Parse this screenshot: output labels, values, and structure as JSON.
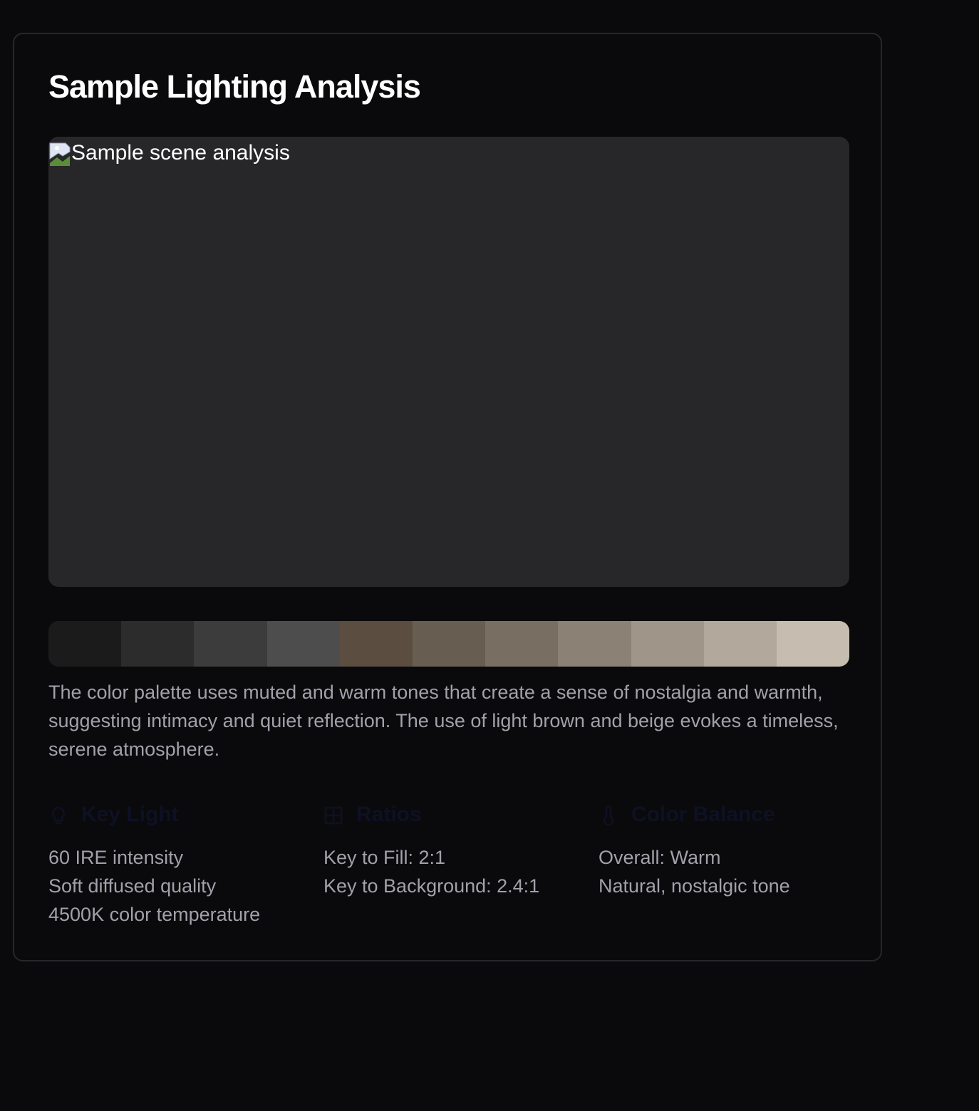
{
  "title": "Sample Lighting Analysis",
  "image": {
    "alt": "Sample scene analysis",
    "broken_icon": "broken-image-icon"
  },
  "palette": [
    "#1b1b1b",
    "#2c2c2c",
    "#3c3c3c",
    "#4d4d4d",
    "#5c4d41",
    "#685d51",
    "#786e62",
    "#8b8174",
    "#9f9589",
    "#b2a89c",
    "#c6bcb0"
  ],
  "description": "The color palette uses muted and warm tones that create a sense of nostalgia and warmth, suggesting intimacy and quiet reflection. The use of light brown and beige evokes a timeless, serene atmosphere.",
  "metrics": [
    {
      "heading": "Key Light",
      "icon": "light-bulb-icon",
      "lines": [
        "60 IRE intensity",
        "Soft diffused quality",
        "4500K color temperature"
      ]
    },
    {
      "heading": "Ratios",
      "icon": "grid-icon",
      "lines": [
        "Key to Fill: 2:1",
        "Key to Background: 2.4:1"
      ]
    },
    {
      "heading": "Color Balance",
      "icon": "thermometer-icon",
      "lines": [
        "Overall: Warm",
        "Natural, nostalgic tone"
      ]
    }
  ],
  "colors": {
    "background": "#0a0a0c",
    "card_border": "#26272b",
    "image_placeholder": "#27272a",
    "title": "#ffffff",
    "body_text": "#a1a1aa",
    "heading_text": "#0e1024"
  }
}
